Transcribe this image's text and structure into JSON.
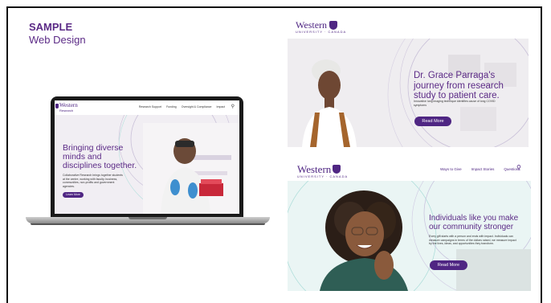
{
  "slide": {
    "title": "SAMPLE",
    "subtitle": "Web Design"
  },
  "laptop_site": {
    "logo": "Western",
    "logo_sub": "Research",
    "nav_links": [
      "Research Support",
      "Funding",
      "Oversight & Compliance",
      "Impact"
    ],
    "search_icon": "search-icon",
    "headline": "Bringing diverse minds and disciplines together.",
    "body": "Collaborative Research brings together students at the centre, working with faculty, business, communities, non-profits and government agencies.",
    "button": "Learn More"
  },
  "panel1": {
    "logo": "Western",
    "logo_sub": "UNIVERSITY · CANADA",
    "headline": "Dr. Grace Parraga's journey from research study to patient care.",
    "body": "Innovative lung imaging technique identifies cause of long COVID symptoms",
    "button": "Read More"
  },
  "panel2": {
    "logo": "Western",
    "logo_sub": "UNIVERSITY · CANADA",
    "nav_links": [
      "Ways to Give",
      "Impact Stories",
      "Questions"
    ],
    "search_icon": "search-icon",
    "headline": "Individuals like you make our community stronger",
    "body": "Every gift starts with a person and ends with impact. Individuals can measure campaigns in terms of the dollars raised, we measure impact by the lives, ideas, and opportunities they transform.",
    "button": "Read More"
  },
  "colors": {
    "brand_purple": "#4f2683",
    "headline_purple": "#5b2a86"
  }
}
